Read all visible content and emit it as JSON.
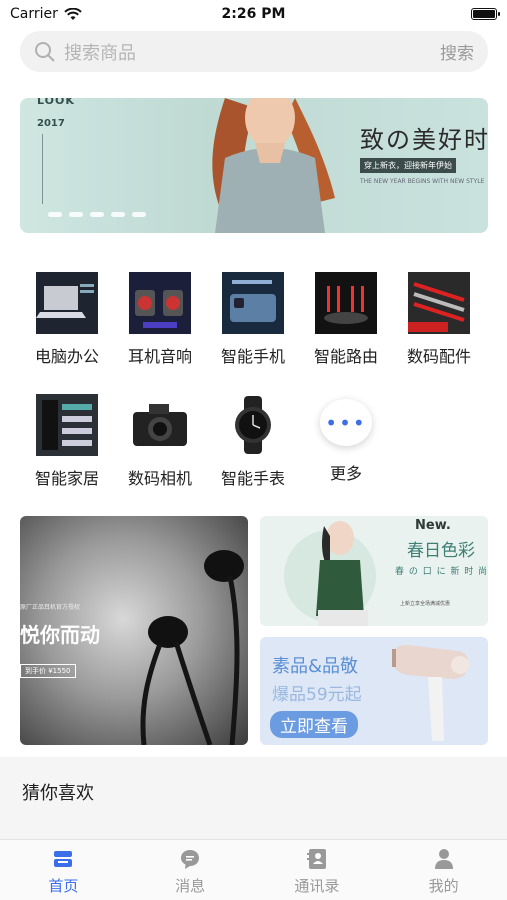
{
  "status_bar": {
    "carrier": "Carrier",
    "time": "2:26 PM"
  },
  "search": {
    "placeholder": "搜索商品",
    "button": "搜索"
  },
  "banner": {
    "look": "LOOK",
    "year": "2017",
    "headline": "致の美好时",
    "sub": "穿上新衣，迎接新年伊始",
    "sub2": "THE NEW YEAR BEGINS WITH NEW STYLE",
    "slides": 5
  },
  "categories": [
    {
      "label": "电脑办公",
      "icon": "laptop-icon"
    },
    {
      "label": "耳机音响",
      "icon": "speaker-icon"
    },
    {
      "label": "智能手机",
      "icon": "phone-icon"
    },
    {
      "label": "智能路由",
      "icon": "router-icon"
    },
    {
      "label": "数码配件",
      "icon": "cable-icon"
    },
    {
      "label": "智能家居",
      "icon": "smart-home-icon"
    },
    {
      "label": "数码相机",
      "icon": "camera-icon"
    },
    {
      "label": "智能手表",
      "icon": "watch-icon"
    },
    {
      "label": "更多",
      "icon": "more-icon"
    }
  ],
  "promo_left": {
    "tag": "原厂正品耳机官方授权",
    "title": "悦你而动",
    "price": "到手价 ¥1550"
  },
  "promo_right_top": {
    "new": "New.",
    "title": "春日色彩",
    "sub": "春 の 口 に 新 时 尚",
    "sub2": "上新立享全场满减优惠"
  },
  "promo_right_bottom": {
    "line1": "素品&品敬",
    "line2": "爆品59元起",
    "cta": "立即查看"
  },
  "guess": {
    "label": "猜你喜欢"
  },
  "tabbar": [
    {
      "label": "首页",
      "icon": "home-icon",
      "active": true
    },
    {
      "label": "消息",
      "icon": "chat-icon",
      "active": false
    },
    {
      "label": "通讯录",
      "icon": "contacts-icon",
      "active": false
    },
    {
      "label": "我的",
      "icon": "user-icon",
      "active": false
    }
  ],
  "colors": {
    "accent": "#3b6ee8",
    "inactive": "#999999"
  }
}
